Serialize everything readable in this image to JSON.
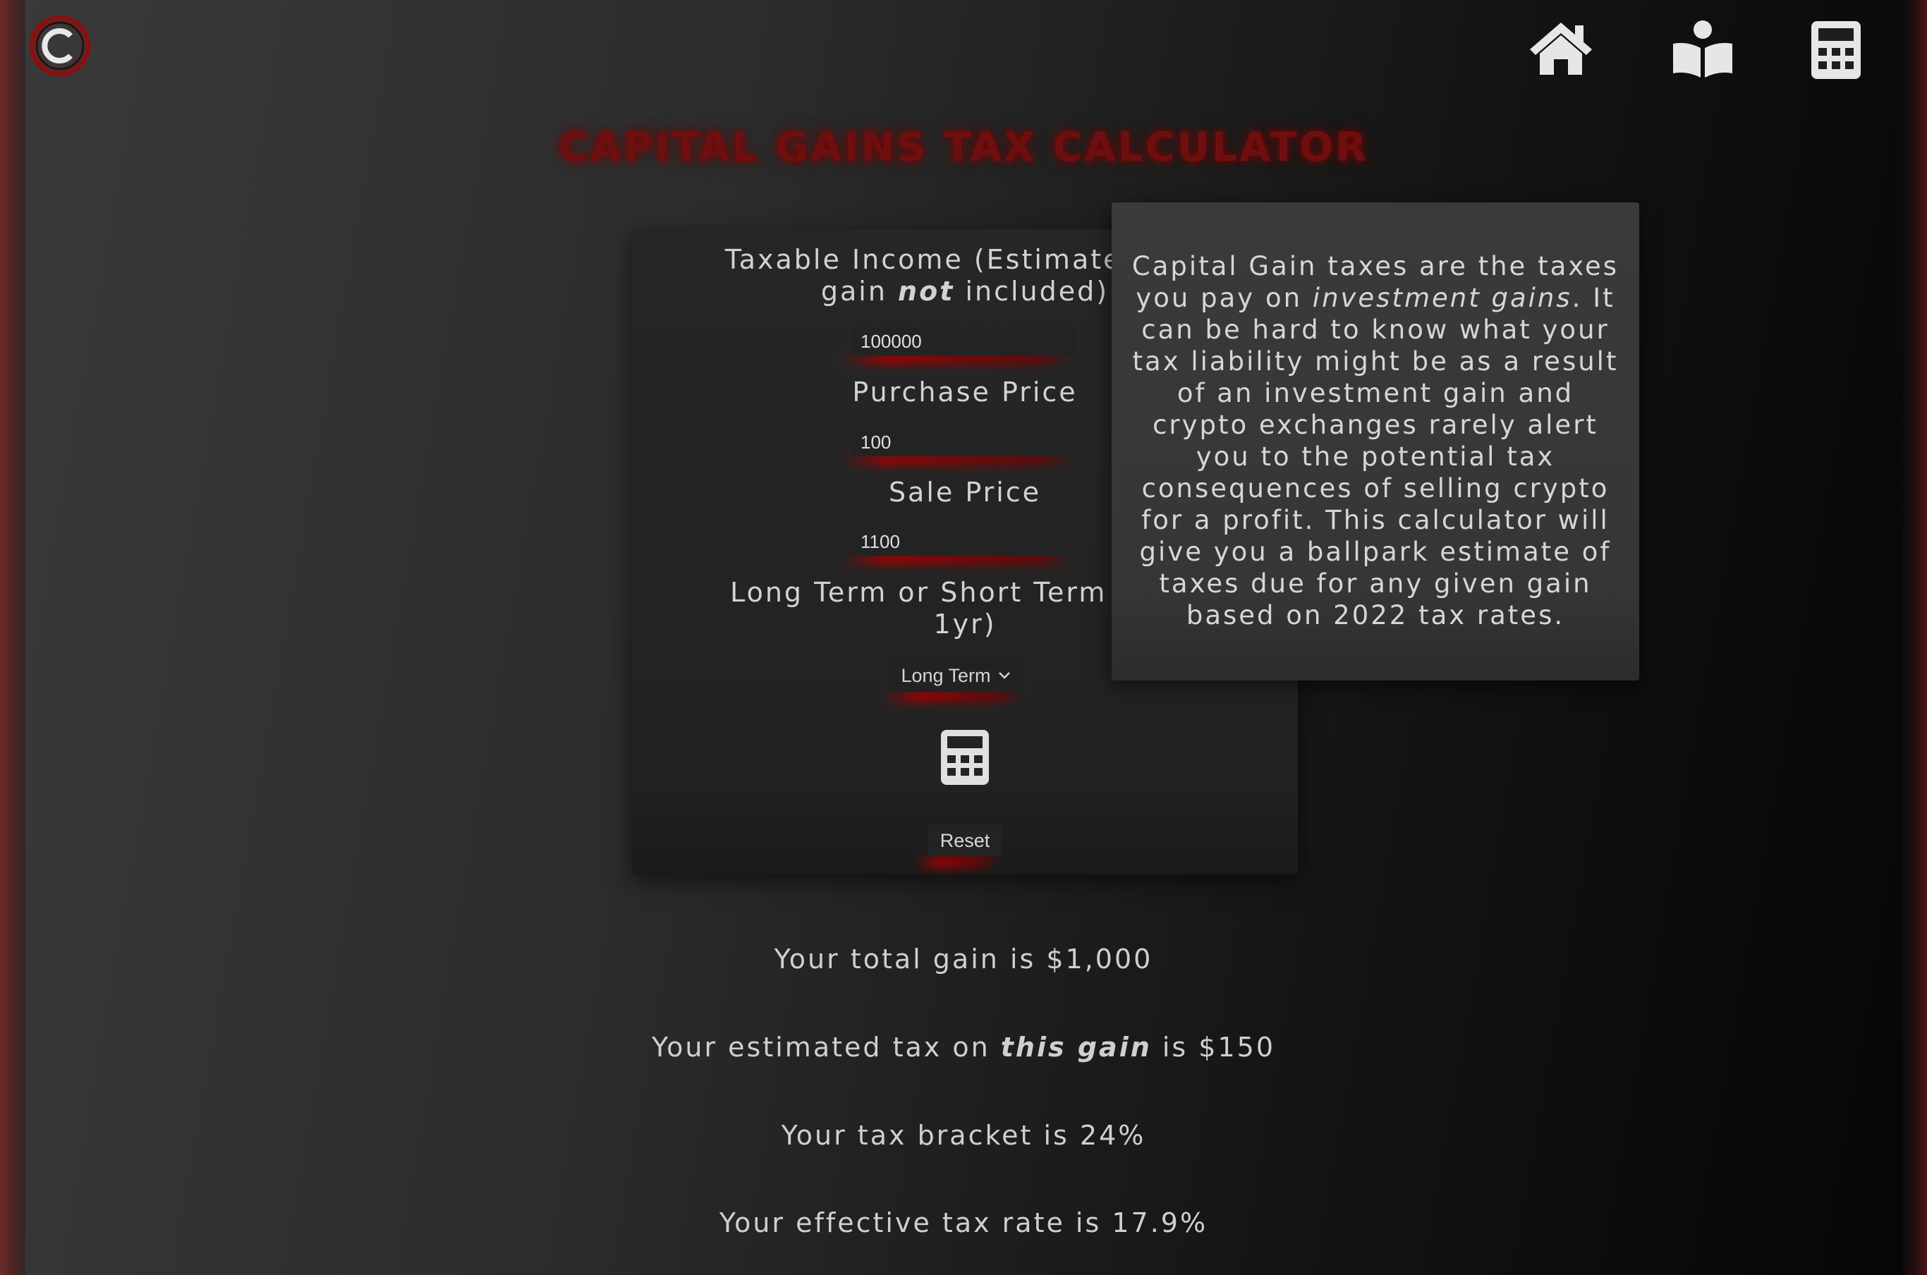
{
  "page_title": "CAPITAL GAINS TAX CALCULATOR",
  "nav": {
    "logo_icon": "copyright-circle-logo",
    "items": [
      {
        "name": "home",
        "icon": "home-icon"
      },
      {
        "name": "learn",
        "icon": "book-reader-icon"
      },
      {
        "name": "calculator",
        "icon": "calculator-icon"
      }
    ]
  },
  "form": {
    "taxable_income": {
      "label_line1": "Taxable Income (Estimate base",
      "label_pre": "gain",
      "label_em": "not",
      "label_post": "included)",
      "value": "100000"
    },
    "purchase_price": {
      "label": "Purchase Price",
      "value": "100"
    },
    "sale_price": {
      "label": "Sale Price",
      "value": "1100"
    },
    "term": {
      "label_line1": "Long Term or Short Term (Held",
      "label_line2": "1yr)",
      "selected": "Long Term"
    },
    "calculate_icon": "calculator-icon",
    "reset_label": "Reset"
  },
  "info": {
    "pre": "Capital Gain taxes are the taxes you pay on",
    "em": "investment gains",
    "post": ". It can be hard to know what your tax liability might be as a result of an investment gain and crypto exchanges rarely alert you to the potential tax consequences of selling crypto for a profit. This calculator will give you a ballpark estimate of taxes due for any given gain based on 2022 tax rates."
  },
  "results": {
    "total_gain": "Your total gain is $1,000",
    "est_tax_pre": "Your estimated tax on",
    "est_tax_em": "this gain",
    "est_tax_post": "is $150",
    "bracket": "Your tax bracket is 24%",
    "effective_rate": "Your effective tax rate is 17.9%"
  },
  "colors": {
    "accent": "#8b0000",
    "icon": "#e6e6e6",
    "text": "#cfcfcf"
  }
}
